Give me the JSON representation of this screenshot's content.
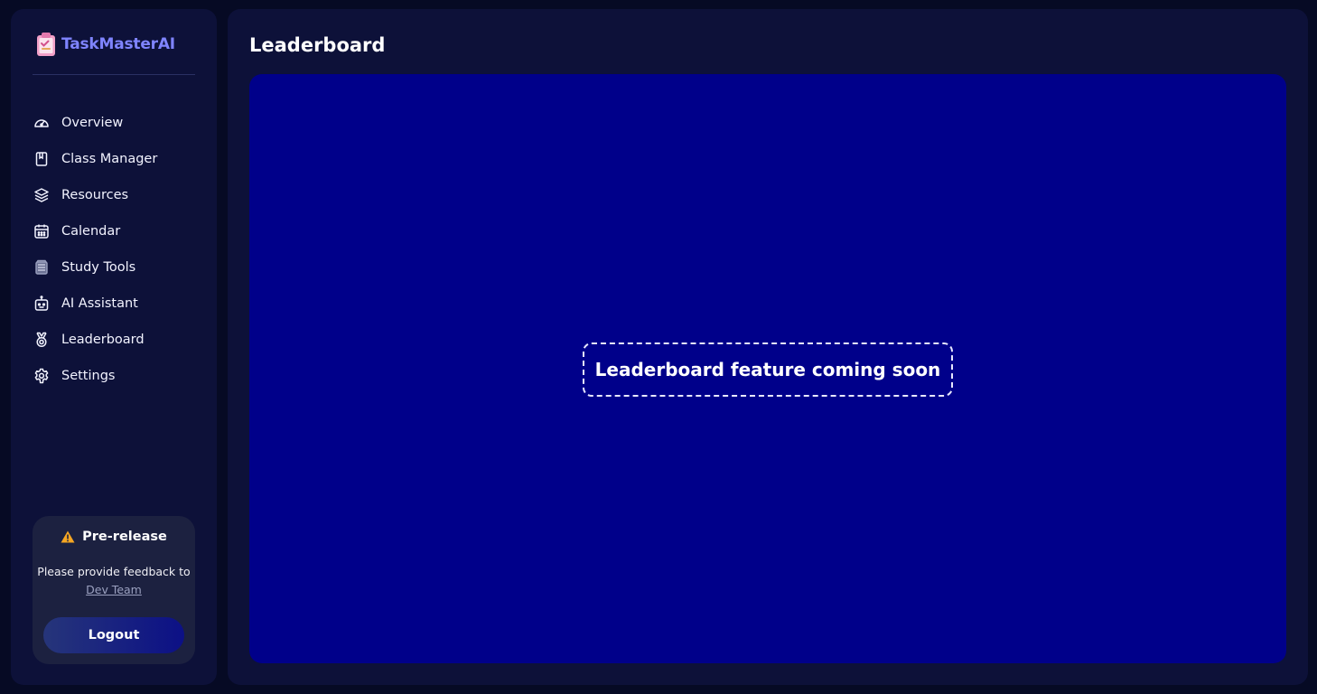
{
  "app": {
    "name": "TaskMasterAI",
    "logo_icon": "clipboard-icon",
    "brand_color": "#7f84ff"
  },
  "sidebar": {
    "items": [
      {
        "label": "Overview",
        "icon": "gauge-icon"
      },
      {
        "label": "Class Manager",
        "icon": "notebook-icon"
      },
      {
        "label": "Resources",
        "icon": "layers-icon"
      },
      {
        "label": "Calendar",
        "icon": "calendar-icon"
      },
      {
        "label": "Study Tools",
        "icon": "books-icon"
      },
      {
        "label": "AI Assistant",
        "icon": "robot-icon"
      },
      {
        "label": "Leaderboard",
        "icon": "medal-icon"
      },
      {
        "label": "Settings",
        "icon": "gear-icon"
      }
    ],
    "prerelease": {
      "title": "Pre-release",
      "icon": "warning-icon",
      "text": "Please provide feedback to",
      "link": "Dev Team",
      "warning_color": "#f5a623"
    },
    "logout_label": "Logout"
  },
  "main": {
    "title": "Leaderboard",
    "placeholder": "Leaderboard feature coming soon",
    "panel_color": "#00008a"
  }
}
